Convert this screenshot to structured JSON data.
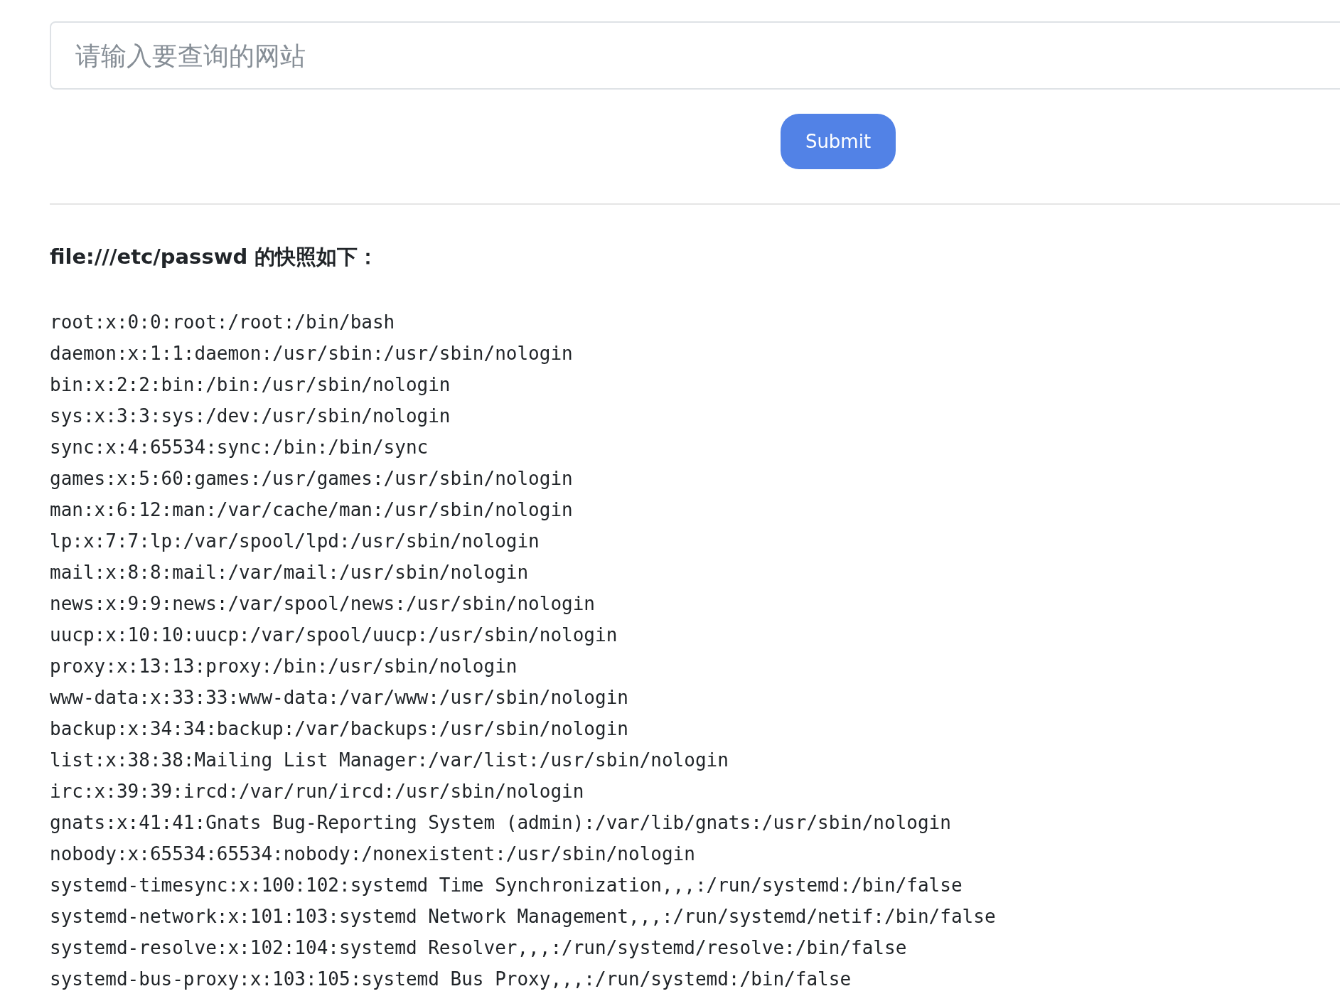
{
  "search": {
    "placeholder": "请输入要查询的网站"
  },
  "submit_button": {
    "label": "Submit"
  },
  "result": {
    "heading": "file:///etc/passwd 的快照如下：",
    "lines": [
      "root:x:0:0:root:/root:/bin/bash",
      "daemon:x:1:1:daemon:/usr/sbin:/usr/sbin/nologin",
      "bin:x:2:2:bin:/bin:/usr/sbin/nologin",
      "sys:x:3:3:sys:/dev:/usr/sbin/nologin",
      "sync:x:4:65534:sync:/bin:/bin/sync",
      "games:x:5:60:games:/usr/games:/usr/sbin/nologin",
      "man:x:6:12:man:/var/cache/man:/usr/sbin/nologin",
      "lp:x:7:7:lp:/var/spool/lpd:/usr/sbin/nologin",
      "mail:x:8:8:mail:/var/mail:/usr/sbin/nologin",
      "news:x:9:9:news:/var/spool/news:/usr/sbin/nologin",
      "uucp:x:10:10:uucp:/var/spool/uucp:/usr/sbin/nologin",
      "proxy:x:13:13:proxy:/bin:/usr/sbin/nologin",
      "www-data:x:33:33:www-data:/var/www:/usr/sbin/nologin",
      "backup:x:34:34:backup:/var/backups:/usr/sbin/nologin",
      "list:x:38:38:Mailing List Manager:/var/list:/usr/sbin/nologin",
      "irc:x:39:39:ircd:/var/run/ircd:/usr/sbin/nologin",
      "gnats:x:41:41:Gnats Bug-Reporting System (admin):/var/lib/gnats:/usr/sbin/nologin",
      "nobody:x:65534:65534:nobody:/nonexistent:/usr/sbin/nologin",
      "systemd-timesync:x:100:102:systemd Time Synchronization,,,:/run/systemd:/bin/false",
      "systemd-network:x:101:103:systemd Network Management,,,:/run/systemd/netif:/bin/false",
      "systemd-resolve:x:102:104:systemd Resolver,,,:/run/systemd/resolve:/bin/false",
      "systemd-bus-proxy:x:103:105:systemd Bus Proxy,,,:/run/systemd:/bin/false"
    ]
  }
}
